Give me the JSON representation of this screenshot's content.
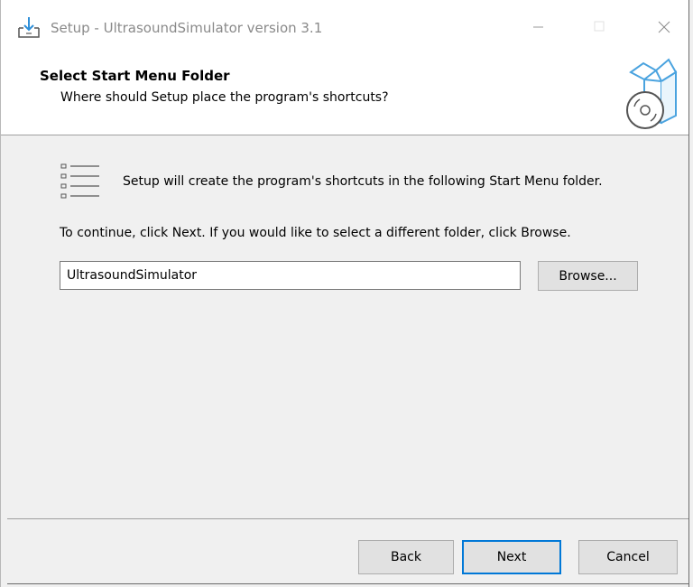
{
  "window": {
    "title": "Setup - UltrasoundSimulator version 3.1",
    "controls": {
      "minimize_icon": "minimize-icon",
      "maximize_icon": "maximize-icon",
      "close_icon": "close-icon"
    }
  },
  "header": {
    "title": "Select Start Menu Folder",
    "subtitle": "Where should Setup place the program's shortcuts?"
  },
  "body": {
    "info": "Setup will create the program's shortcuts in the following Start Menu folder.",
    "instruction": "To continue, click Next. If you would like to select a different folder, click Browse.",
    "folder_value": "UltrasoundSimulator",
    "browse_label": "Browse..."
  },
  "footer": {
    "back_label": "Back",
    "next_label": "Next",
    "cancel_label": "Cancel"
  },
  "colors": {
    "accent": "#0078d7",
    "window_bg": "#f0f0f0",
    "header_bg": "#ffffff",
    "icon_blue": "#4aa3df"
  }
}
